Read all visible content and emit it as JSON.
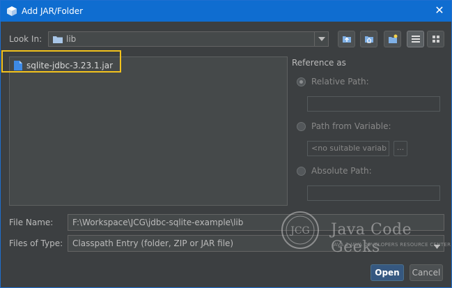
{
  "window": {
    "title": "Add JAR/Folder",
    "accent": "#0f6dd0"
  },
  "look_in": {
    "label": "Look In:",
    "value": "lib"
  },
  "files": [
    {
      "name": "sqlite-jdbc-3.23.1.jar",
      "icon": "jar-file-icon"
    }
  ],
  "reference": {
    "heading": "Reference as",
    "relative_label": "Relative Path:",
    "variable_label": "Path from Variable:",
    "variable_value": "<no suitable variab",
    "browse_label": "...",
    "absolute_label": "Absolute Path:"
  },
  "file_name": {
    "label": "File Name:",
    "value": "F:\\Workspace\\JCG\\jdbc-sqlite-example\\lib"
  },
  "files_of_type": {
    "label": "Files of Type:",
    "value": "Classpath Entry (folder, ZIP or JAR file)"
  },
  "buttons": {
    "open": "Open",
    "cancel": "Cancel"
  },
  "watermark": {
    "logo": "JCG",
    "name": "Java Code Geeks",
    "tagline": "JAVA 2 JAVA DEVELOPERS RESOURCE CENTER"
  },
  "highlight_color": "#f2c21d"
}
